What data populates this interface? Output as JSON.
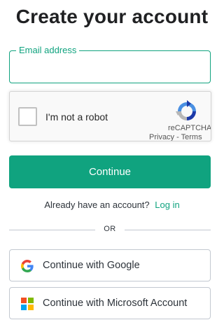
{
  "page": {
    "title": "Create your account"
  },
  "email": {
    "label": "Email address",
    "value": "",
    "placeholder": ""
  },
  "captcha": {
    "checkbox_label": "I'm not a robot",
    "brand": "reCAPTCHA",
    "privacy": "Privacy",
    "separator": "-",
    "terms": "Terms",
    "icon": "recaptcha-logo"
  },
  "actions": {
    "continue_label": "Continue",
    "have_account_text": "Already have an account?",
    "login_label": "Log in",
    "divider_text": "OR",
    "google_label": "Continue with Google",
    "google_icon": "google-icon",
    "microsoft_label": "Continue with Microsoft Account",
    "microsoft_icon": "microsoft-icon"
  },
  "colors": {
    "accent": "#10a37f",
    "title": "#202123",
    "text": "#2d333a",
    "border": "#c2c8d0",
    "ms_red": "#f25022",
    "ms_green": "#7fba00",
    "ms_blue": "#00a4ef",
    "ms_yellow": "#ffb900"
  }
}
